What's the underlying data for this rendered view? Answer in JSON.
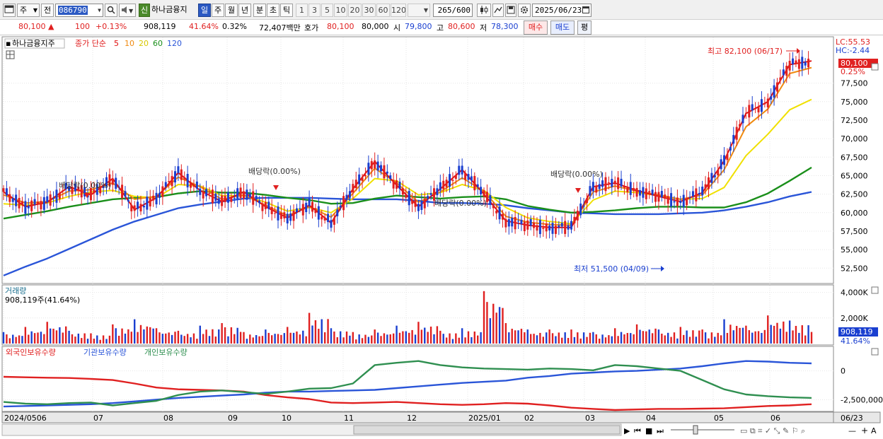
{
  "toolbar": {
    "menu_icon": "window-icon",
    "period_type": "주",
    "prev_label": "전",
    "stock_code": "086790",
    "stock_name": "하나금융지",
    "new_label": "신",
    "periods": [
      "일",
      "주",
      "월",
      "년",
      "분",
      "초",
      "틱"
    ],
    "selected_period": "일",
    "intervals": [
      "1",
      "3",
      "5",
      "10",
      "20",
      "30",
      "60",
      "120"
    ],
    "count": "265",
    "count_total": "/600",
    "date": "2025/06/23"
  },
  "quote": {
    "price": "80,100",
    "change": "100",
    "change_pct": "+0.13%",
    "volume": "908,119",
    "vol_ratio": "41.64%",
    "turnover": "0.32%",
    "amount": "72,407백만",
    "hoga_label": "호가",
    "hoga_ask": "80,100",
    "hoga_bid": "80,000",
    "open_label": "시",
    "open": "79,800",
    "high_label": "고",
    "high": "80,600",
    "low_label": "저",
    "low": "78,300",
    "buy_button": "매수",
    "sell_button": "매도",
    "eval_button": "평"
  },
  "colors": {
    "up": "#e02020",
    "down": "#1a3fd0",
    "ma5": "#e01010",
    "ma10": "#f08a10",
    "ma20": "#f0e000",
    "ma60": "#1a8f1a",
    "ma120": "#2a55d8",
    "foreign": "#e02020",
    "institution": "#2a55d8",
    "individual": "#2f8f50"
  },
  "price_panel": {
    "legend_name": "하나금융지주",
    "legend_type": "종가 단순",
    "ma_labels": [
      "5",
      "10",
      "20",
      "60",
      "120"
    ],
    "lc_label": "LC:55.53",
    "hc_label": "HC:-2.44",
    "last_price_tag": "80,100",
    "last_pct_tag": "0.25%",
    "high_note": "최고 82,100 (06/17)",
    "low_note": "최저 51,500 (04/09)",
    "dividend_notes": [
      "배당락(0.00%)",
      "배당락(0.00%)",
      "배당락(0.00%)",
      "배당락(0.00%)"
    ],
    "y_ticks": [
      "77,500",
      "75,000",
      "72,500",
      "70,000",
      "67,500",
      "65,000",
      "62,500",
      "60,000",
      "57,500",
      "55,000",
      "52,500"
    ]
  },
  "volume_panel": {
    "title": "거래량",
    "value": "908,119주(41.64%)",
    "y_ticks": [
      "4,000K",
      "2,000K"
    ],
    "last_tag": "908,119",
    "last_pct": "41.64%"
  },
  "holdings_panel": {
    "series": [
      "외국인보유수량",
      "기관보유수량",
      "개인보유수량"
    ],
    "y_ticks": [
      "0",
      "-2,500,000"
    ]
  },
  "x_axis": {
    "labels": [
      "2024/0506",
      "07",
      "08",
      "09",
      "10",
      "11",
      "12",
      "2025/01",
      "02",
      "03",
      "04",
      "05",
      "06"
    ],
    "last_label": "06/23"
  },
  "chart_data": [
    {
      "type": "candlestick",
      "title": "하나금융지주",
      "series": [
        {
          "name": "5",
          "values": [
            62800,
            60800,
            61400,
            63500,
            62400,
            64600,
            60400,
            62000,
            65400,
            63000,
            61500,
            62800,
            60800,
            59300,
            61000,
            58600,
            63200,
            66900,
            63700,
            60800,
            63200,
            65800,
            62500,
            58900,
            58300,
            58000,
            58000,
            63500,
            64000,
            63000,
            62200,
            61500,
            62700,
            67000,
            73400,
            75000,
            80000,
            80500
          ]
        },
        {
          "name": "10",
          "values": [
            62400,
            61300,
            61500,
            62900,
            63100,
            64000,
            61800,
            62200,
            64800,
            63500,
            61800,
            62400,
            61000,
            59600,
            60800,
            59400,
            62600,
            66000,
            64000,
            61400,
            62800,
            64700,
            62900,
            59500,
            58700,
            58400,
            58300,
            62800,
            63600,
            62900,
            62400,
            61800,
            62400,
            65800,
            71600,
            74000,
            78800,
            79600
          ]
        },
        {
          "name": "20",
          "values": [
            61200,
            61000,
            61300,
            62200,
            62800,
            63000,
            62200,
            62000,
            63800,
            63600,
            62300,
            62300,
            61400,
            60200,
            60700,
            60000,
            61900,
            64600,
            64300,
            62400,
            62700,
            63800,
            63000,
            60700,
            59300,
            58800,
            58500,
            61700,
            62900,
            62700,
            62300,
            61800,
            61900,
            63400,
            67700,
            70600,
            73900,
            75300
          ]
        },
        {
          "name": "60",
          "values": [
            59200,
            59700,
            60200,
            60800,
            61300,
            61800,
            62000,
            62100,
            62600,
            62900,
            62700,
            62700,
            62400,
            62000,
            61700,
            61200,
            61300,
            61900,
            62300,
            62100,
            61900,
            62100,
            62200,
            61800,
            60900,
            60400,
            60000,
            60100,
            60300,
            60600,
            60800,
            60800,
            60700,
            60700,
            61400,
            62600,
            64300,
            66100
          ]
        },
        {
          "name": "120",
          "values": [
            51500,
            52700,
            53800,
            55100,
            56400,
            57700,
            58800,
            59700,
            60600,
            61100,
            61500,
            61900,
            62000,
            62000,
            62000,
            61900,
            61800,
            61800,
            61800,
            61600,
            61300,
            61300,
            61200,
            61000,
            60600,
            60300,
            60000,
            59900,
            59800,
            59800,
            59800,
            59900,
            60000,
            60300,
            60800,
            61400,
            62200,
            62800
          ]
        }
      ],
      "x": [
        "2024/05",
        "06",
        "07",
        "08",
        "09",
        "10",
        "11",
        "12",
        "2025/01",
        "02",
        "03",
        "04",
        "05",
        "06"
      ],
      "ylim": [
        51000,
        83000
      ]
    },
    {
      "type": "bar",
      "title": "거래량",
      "values": [
        900,
        1300,
        1700,
        1000,
        800,
        1500,
        1900,
        1200,
        1000,
        1400,
        1600,
        900,
        1100,
        1300,
        2400,
        1200,
        900,
        1100,
        1400,
        1700,
        1000,
        1200,
        4100,
        1600,
        1100,
        1100,
        1100,
        900,
        1200,
        1500,
        1100,
        1300,
        1100,
        1900,
        1400,
        2200,
        1800,
        908
      ],
      "ylabel": "K",
      "ylim": [
        0,
        4200
      ]
    },
    {
      "type": "line",
      "series": [
        {
          "name": "외국인보유수량",
          "values": [
            -520000,
            -560000,
            -600000,
            -620000,
            -700000,
            -800000,
            -1100000,
            -1450000,
            -1600000,
            -1650000,
            -1700000,
            -1800000,
            -2100000,
            -2300000,
            -2450000,
            -2750000,
            -2800000,
            -2750000,
            -2700000,
            -2800000,
            -2900000,
            -2950000,
            -2900000,
            -2800000,
            -2850000,
            -3000000,
            -3200000,
            -3300000,
            -3400000,
            -3350000,
            -3300000,
            -3300000,
            -3280000,
            -3250000,
            -3150000,
            -3050000,
            -3000000,
            -2900000
          ]
        },
        {
          "name": "기관보유수량",
          "values": [
            -3100000,
            -3050000,
            -3000000,
            -2950000,
            -2900000,
            -2800000,
            -2650000,
            -2500000,
            -2350000,
            -2250000,
            -2150000,
            -2050000,
            -1900000,
            -1800000,
            -1800000,
            -1750000,
            -1700000,
            -1650000,
            -1500000,
            -1350000,
            -1200000,
            -1050000,
            -950000,
            -850000,
            -600000,
            -450000,
            -250000,
            -150000,
            -50000,
            0,
            100000,
            200000,
            400000,
            650000,
            850000,
            800000,
            700000,
            650000
          ]
        },
        {
          "name": "개인보유수량",
          "values": [
            -2700000,
            -2850000,
            -2900000,
            -2800000,
            -2750000,
            -3000000,
            -2800000,
            -2600000,
            -2100000,
            -1800000,
            -1700000,
            -1850000,
            -2000000,
            -1800000,
            -1550000,
            -1500000,
            -1100000,
            500000,
            700000,
            850000,
            500000,
            300000,
            200000,
            150000,
            100000,
            200000,
            150000,
            50000,
            500000,
            400000,
            200000,
            0,
            -800000,
            -1600000,
            -2050000,
            -2200000,
            -2300000,
            -2350000
          ]
        }
      ],
      "ylim": [
        -3400000,
        1200000
      ]
    }
  ]
}
